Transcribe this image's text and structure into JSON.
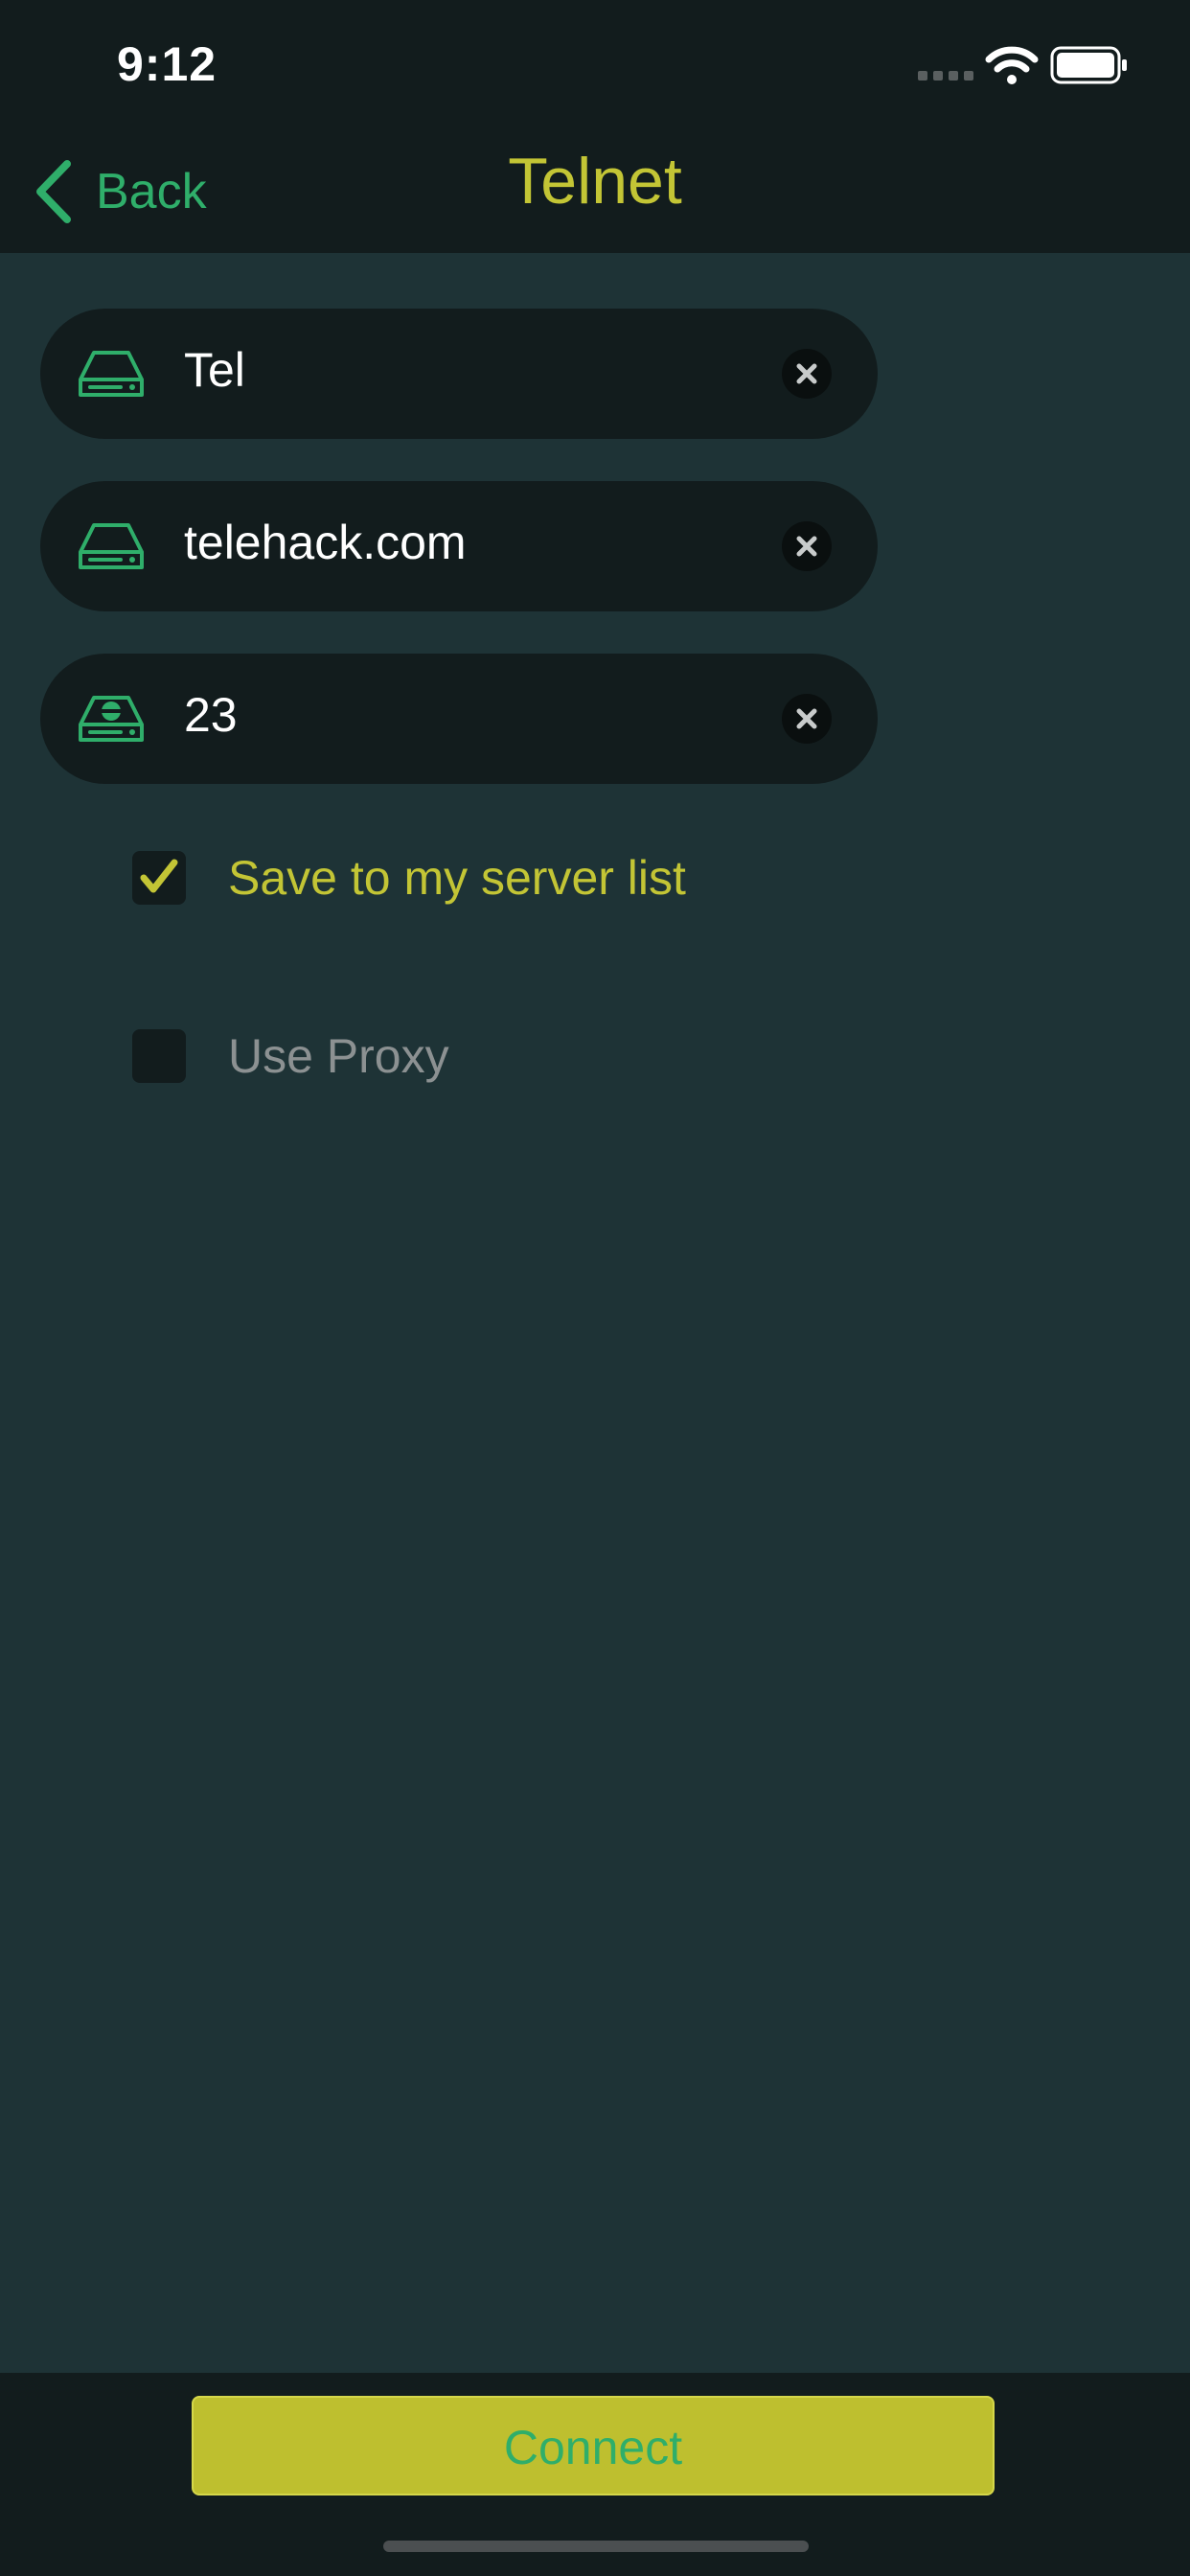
{
  "status_bar": {
    "time": "9:12"
  },
  "nav": {
    "back_label": "Back",
    "title": "Telnet"
  },
  "fields": [
    {
      "value": "Tel",
      "icon": "server-drive-icon"
    },
    {
      "value": "telehack.com",
      "icon": "server-drive-icon"
    },
    {
      "value": "23",
      "icon": "server-port-icon"
    }
  ],
  "options": {
    "save": {
      "label": "Save to my server list",
      "checked": true
    },
    "proxy": {
      "label": "Use Proxy",
      "checked": false
    }
  },
  "actions": {
    "connect_label": "Connect"
  },
  "colors": {
    "background": "#1e3336",
    "bar": "#121c1d",
    "accent_yellow": "#c3c535",
    "accent_green": "#2fae6a",
    "button": "#bebf2f"
  }
}
